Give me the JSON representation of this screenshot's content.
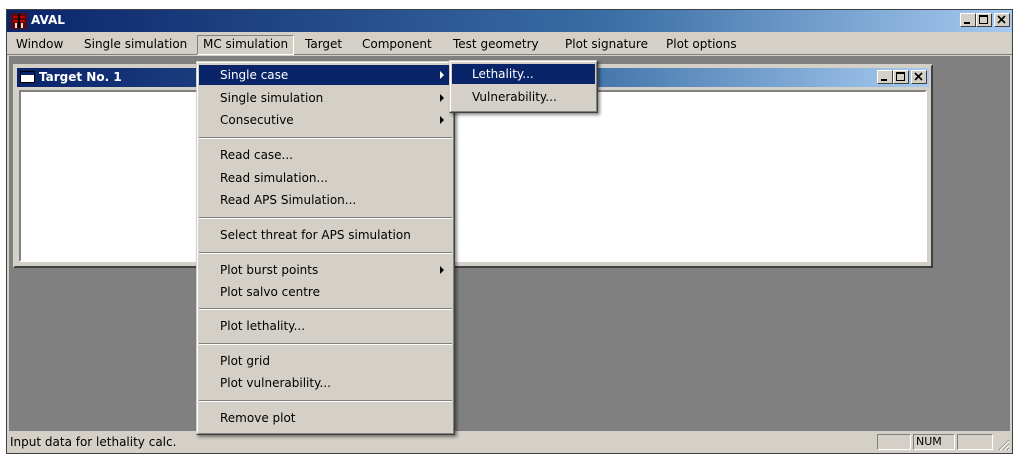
{
  "app": {
    "title": "AVAL"
  },
  "menubar": [
    "Window",
    "Single simulation",
    "MC simulation",
    "Target",
    "Component",
    "Test geometry",
    "Plot signature",
    "Plot options"
  ],
  "child_window": {
    "title": "Target No. 1"
  },
  "dropdown": {
    "items": [
      {
        "label": "Single case",
        "has_submenu": true,
        "highlighted": true
      },
      {
        "label": "Single simulation",
        "has_submenu": true
      },
      {
        "label": "Consecutive",
        "has_submenu": true
      },
      {
        "label": "Read case..."
      },
      {
        "label": "Read simulation..."
      },
      {
        "label": "Read APS Simulation..."
      },
      {
        "label": "Select threat for APS simulation"
      },
      {
        "label": "Plot burst points",
        "has_submenu": true
      },
      {
        "label": "Plot salvo centre"
      },
      {
        "label": "Plot lethality..."
      },
      {
        "label": "Plot grid"
      },
      {
        "label": "Plot vulnerability..."
      },
      {
        "label": "Remove plot"
      }
    ]
  },
  "submenu": {
    "items": [
      {
        "label": "Lethality...",
        "highlighted": true
      },
      {
        "label": "Vulnerability..."
      }
    ]
  },
  "statusbar": {
    "text": "Input data for lethality calc.",
    "num": "NUM"
  },
  "colors": {
    "titlebar_active": "#0a246a",
    "face": "#d4d0c8",
    "mdi_bg": "#808080",
    "highlight": "#0a246a"
  },
  "icons": [
    "aval-app-icon",
    "minimize-icon",
    "maximize-icon",
    "close-icon",
    "window-icon",
    "submenu-arrow-icon",
    "size-grip-icon"
  ]
}
